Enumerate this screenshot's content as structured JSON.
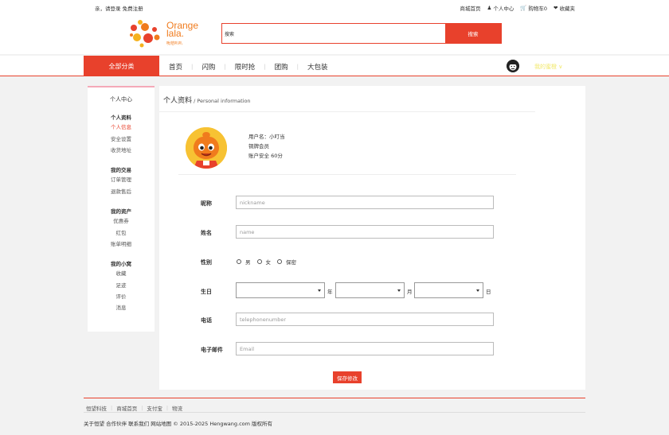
{
  "topbar": {
    "greeting": "亲，请登录 免费注册",
    "links": [
      "商城首页",
      "个人中心",
      "购物车0",
      "收藏夹"
    ]
  },
  "logo": {
    "line1": "Orange",
    "line2": "lala.",
    "sub": "吮桔叭叭"
  },
  "search": {
    "value": "搜索",
    "button": "搜索"
  },
  "nav": {
    "category": "全部分类",
    "links": [
      "首页",
      "闪购",
      "限时抢",
      "团购",
      "大包装"
    ],
    "my_center": "我的蜜橙"
  },
  "sidebar": {
    "title": "个人中心",
    "groups": [
      {
        "heading": "个人资料",
        "items": [
          "个人信息",
          "安全设置",
          "收货地址"
        ],
        "active": 0
      },
      {
        "heading": "我的交易",
        "items": [
          "订单管理",
          "退款售后"
        ]
      },
      {
        "heading": "我的资产",
        "items": [
          "优惠券",
          "红包",
          "账单明细"
        ]
      },
      {
        "heading": "我的小窝",
        "items": [
          "收藏",
          "足迹",
          "评价",
          "消息"
        ]
      }
    ]
  },
  "main": {
    "title": "个人资料",
    "subtitle": " / Personal information",
    "user": {
      "username": "用户名：小叮当",
      "level": "铜牌会员",
      "security": "账户安全 60分"
    },
    "form": {
      "nickname_label": "昵称",
      "nickname_placeholder": "nickname",
      "name_label": "姓名",
      "name_placeholder": "name",
      "gender_label": "性别",
      "gender_options": [
        "男",
        "女",
        "保密"
      ],
      "birthday_label": "生日",
      "year_unit": "年",
      "month_unit": "月",
      "day_unit": "日",
      "phone_label": "电话",
      "phone_placeholder": "telephonenumber",
      "email_label": "电子邮件",
      "email_placeholder": "Email",
      "save_button": "保存修改"
    }
  },
  "footer": {
    "links": [
      "恒望科技",
      "商城首页",
      "支付宝",
      "物流"
    ],
    "copyright": "关于恒望 合作伙伴 联系我们 网站地图 © 2015-2025 Hengwang.com 版权所有"
  },
  "colors": {
    "accent": "#e8412c",
    "brand_orange": "#f07b1d",
    "sidebar_top": "#f5a9b8"
  }
}
